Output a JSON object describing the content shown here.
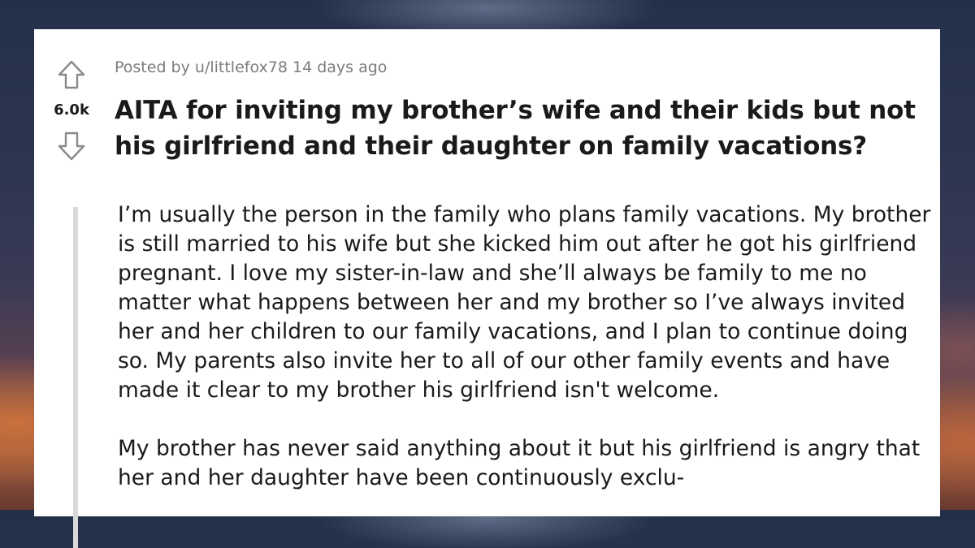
{
  "post": {
    "score": "6.0k",
    "posted_by_prefix": "Posted by",
    "username": "u/littlefox78",
    "age": "14 days ago",
    "title": "AITA for inviting my brother’s wife and their kids but not his girlfriend and their daughter on family vacations?",
    "paragraphs": [
      "I’m usually the person in the family who plans family vacations. My brother is still married to his wife but she kicked him out after he got his girlfriend pregnant. I love my sister-in-law and she’ll always be family to me no matter what happens between her and my brother so I’ve always invited her and her children to our family vacations, and I plan to continue doing so. My parents also invite her to all of our other family events and have made it clear to my brother his girlfriend isn't welcome.",
      "My brother has never said anything about it but his girlfriend is angry that her and her daughter have been continuously exclu-"
    ]
  },
  "icons": {
    "upvote": "upvote-arrow-icon",
    "downvote": "downvote-arrow-icon"
  },
  "colors": {
    "text": "#1a1a1b",
    "meta": "#7c7c7c",
    "arrow": "#878a8c",
    "quote_bar": "#d9d9d9"
  }
}
